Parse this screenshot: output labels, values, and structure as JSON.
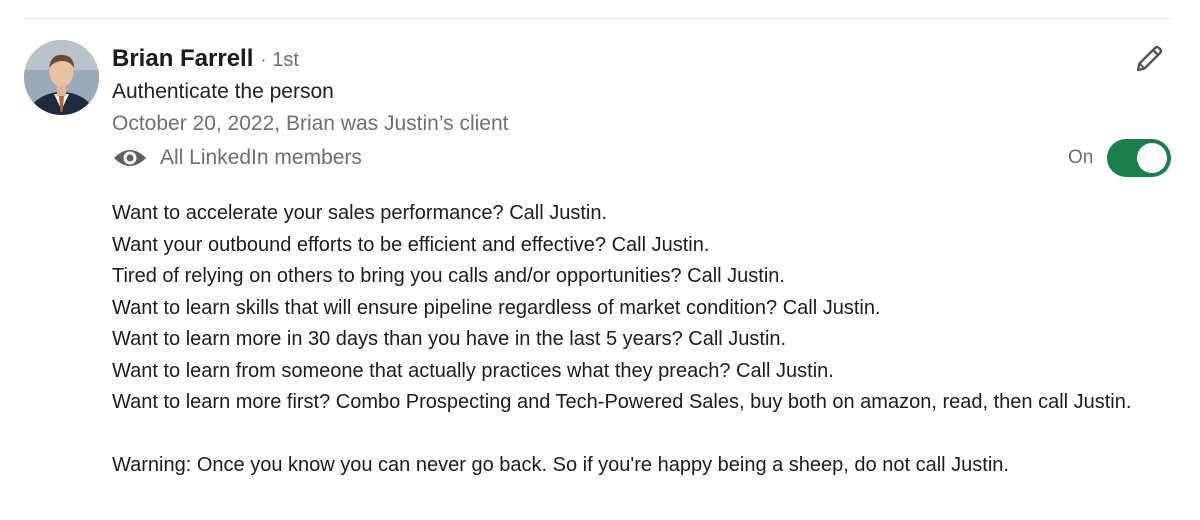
{
  "recommendation": {
    "author_name": "Brian Farrell",
    "connection_degree": "· 1st",
    "relationship": "Authenticate the person",
    "date_context": "October 20, 2022, Brian was Justin’s client",
    "visibility_label": "All LinkedIn members",
    "visibility_icon": "eye-icon",
    "edit_icon": "pencil-icon",
    "toggle": {
      "label": "On",
      "state": true,
      "color": "#1a7f4a"
    },
    "text_lines": [
      "Want to accelerate your sales performance? Call Justin.",
      "Want your outbound efforts to be efficient and effective? Call Justin.",
      "Tired of relying on others to bring you calls and/or opportunities? Call Justin.",
      "Want to learn skills that will ensure pipeline regardless of market condition? Call Justin.",
      "Want to learn more in 30 days than you have in the last 5 years? Call Justin.",
      "Want to learn from someone that actually practices what they preach? Call Justin.",
      "Want to learn more first? Combo Prospecting and Tech-Powered Sales, buy both on amazon, read, then call Justin."
    ],
    "warning": "Warning: Once you know you can never go back. So if you're happy being a sheep, do not call Justin."
  }
}
